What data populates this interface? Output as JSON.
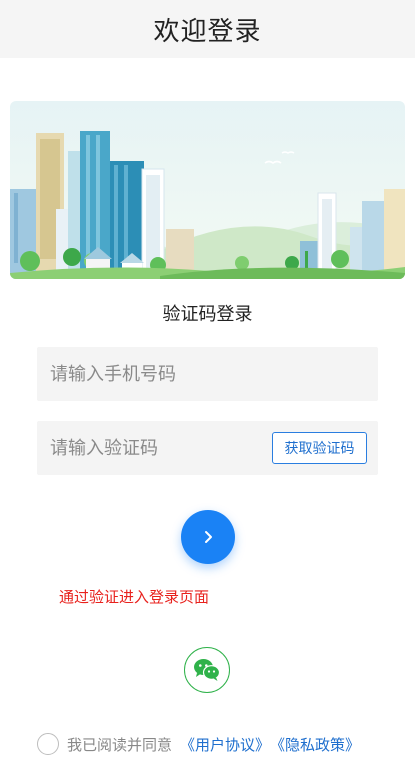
{
  "header": {
    "title": "欢迎登录"
  },
  "subtitle": "验证码登录",
  "form": {
    "phone_placeholder": "请输入手机号码",
    "code_placeholder": "请输入验证码",
    "get_code_label": "获取验证码"
  },
  "hint": "通过验证进入登录页面",
  "agreement": {
    "text": "我已阅读并同意",
    "user_agreement": "《用户协议》",
    "privacy_policy": "《隐私政策》"
  },
  "colors": {
    "accent": "#1a82f5",
    "hint": "#e8211d",
    "wechat": "#2fb24a"
  },
  "icons": {
    "submit": "chevron-right-icon",
    "wechat": "wechat-icon",
    "checkbox": "circle-checkbox"
  }
}
